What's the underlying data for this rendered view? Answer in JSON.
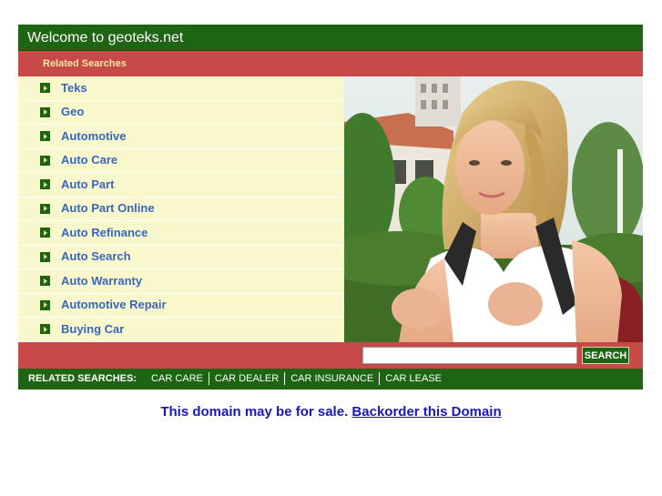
{
  "header": {
    "title": "Welcome to geoteks.net"
  },
  "related_header": {
    "label": "Related Searches"
  },
  "links": [
    {
      "label": "Teks"
    },
    {
      "label": "Geo"
    },
    {
      "label": "Automotive"
    },
    {
      "label": "Auto Care"
    },
    {
      "label": "Auto Part"
    },
    {
      "label": "Auto Part Online"
    },
    {
      "label": "Auto Refinance"
    },
    {
      "label": "Auto Search"
    },
    {
      "label": "Auto Warranty"
    },
    {
      "label": "Automotive Repair"
    },
    {
      "label": "Buying Car"
    }
  ],
  "search": {
    "placeholder": "",
    "button_label": "SEARCH"
  },
  "related_bar": {
    "label": "RELATED SEARCHES:",
    "items": [
      {
        "label": "CAR CARE"
      },
      {
        "label": "CAR DEALER"
      },
      {
        "label": "CAR INSURANCE"
      },
      {
        "label": "CAR LEASE"
      }
    ]
  },
  "footer": {
    "text": "This domain may be for sale.",
    "link_label": "Backorder this Domain"
  },
  "colors": {
    "green": "#1e6412",
    "red": "#c84a48",
    "cream": "#f9f7cc",
    "link_blue": "#3b66c0",
    "footer_blue": "#1a17b8"
  },
  "icons": {
    "bullet": "arrow-bullet-icon"
  },
  "image": {
    "alt": "woman-with-backpack-photo"
  }
}
